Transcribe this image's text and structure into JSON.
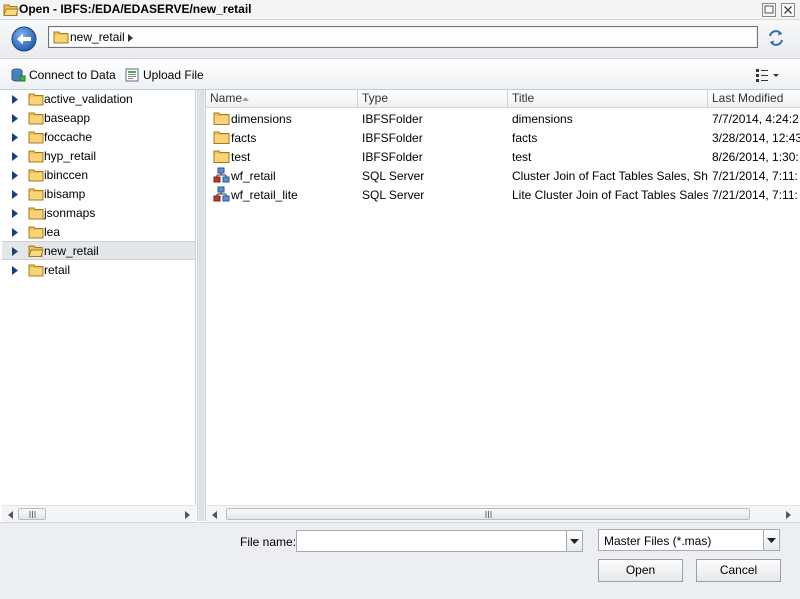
{
  "window": {
    "title": "Open - IBFS:/EDA/EDASERVE/new_retail"
  },
  "navbar": {
    "path_label": "new_retail"
  },
  "toolbar": {
    "connect_label": "Connect to Data",
    "upload_label": "Upload File"
  },
  "tree": {
    "items": [
      {
        "label": "active_validation"
      },
      {
        "label": "baseapp"
      },
      {
        "label": "foccache"
      },
      {
        "label": "hyp_retail"
      },
      {
        "label": "ibinccen"
      },
      {
        "label": "ibisamp"
      },
      {
        "label": "jsonmaps"
      },
      {
        "label": "lea"
      },
      {
        "label": "new_retail"
      },
      {
        "label": "retail"
      }
    ],
    "selected_index": 8
  },
  "files": {
    "columns": {
      "name": "Name",
      "type": "Type",
      "title": "Title",
      "last_modified": "Last Modified"
    },
    "rows": [
      {
        "name": "dimensions",
        "type": "IBFSFolder",
        "title": "dimensions",
        "last_modified": "7/7/2014, 4:24:2",
        "icon": "folder-icon"
      },
      {
        "name": "facts",
        "type": "IBFSFolder",
        "title": "facts",
        "last_modified": "3/28/2014, 12:43",
        "icon": "folder-icon"
      },
      {
        "name": "test",
        "type": "IBFSFolder",
        "title": "test",
        "last_modified": "8/26/2014, 1:30:",
        "icon": "folder-icon"
      },
      {
        "name": "wf_retail",
        "type": "SQL Server",
        "title": "Cluster Join of Fact Tables Sales, Shipme",
        "last_modified": "7/21/2014, 7:11:",
        "icon": "cluster-join-icon"
      },
      {
        "name": "wf_retail_lite",
        "type": "SQL Server",
        "title": "Lite Cluster Join of Fact Tables Sales and",
        "last_modified": "7/21/2014, 7:11:",
        "icon": "cluster-join-icon"
      }
    ]
  },
  "bottom": {
    "filename_label": "File name:",
    "filename_value": "",
    "filter_value": "Master Files (*.mas)",
    "open_label": "Open",
    "cancel_label": "Cancel"
  },
  "colors": {
    "folder": "#f2c14e",
    "back_button": "#2f6ab8",
    "selected_row": "#e4e7ea"
  }
}
